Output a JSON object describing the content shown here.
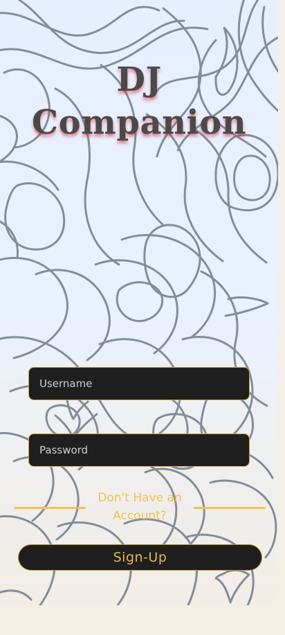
{
  "app": {
    "title_line1": "DJ",
    "title_line2": "Companion"
  },
  "form": {
    "username_placeholder": "Username",
    "username_value": "",
    "password_placeholder": "Password",
    "password_value": ""
  },
  "prompt": {
    "dont_have_account": "Don't Have an Account?"
  },
  "actions": {
    "signup_label": "Sign-Up"
  },
  "theme": {
    "accent": "#f2c14e",
    "input_background": "#1f1f1f",
    "title_text": "#4a4a4a",
    "title_shadow": "#d62828",
    "background_top": "#e7efff",
    "background_bottom": "#f2ede6"
  },
  "icons": {
    "background_pattern": "topographic-lines"
  }
}
